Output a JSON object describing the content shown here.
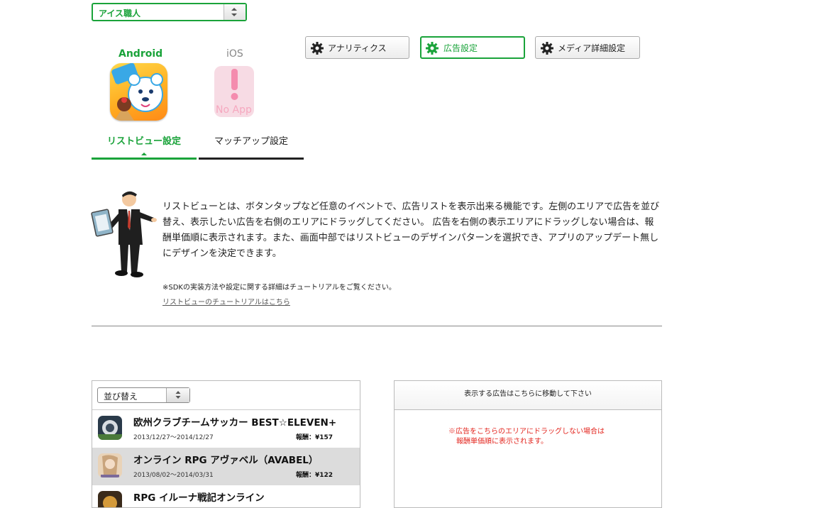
{
  "app_select": {
    "value": "アイス職人"
  },
  "platforms": {
    "android": {
      "label": "Android"
    },
    "ios": {
      "label": "iOS",
      "no_app_text": "No App"
    }
  },
  "buttons": {
    "analytics": "アナリティクス",
    "ad_settings": "広告設定",
    "media_settings": "メディア詳細設定"
  },
  "tabs": {
    "listview": "リストビュー設定",
    "matchup": "マッチアップ設定"
  },
  "description": "リストビューとは、ボタンタップなど任意のイベントで、広告リストを表示出来る機能です。左側のエリアで広告を並び替え、表示したい広告を右側のエリアにドラッグしてください。 広告を右側の表示エリアにドラッグしない場合は、報酬単価順に表示されます。また、画面中部ではリストビューのデザインパターンを選択でき、アプリのアップデート無しにデザインを決定できます。",
  "note": "※SDKの実装方法や設定に関する詳細はチュートリアルをご覧ください。",
  "tutorial_link": "リストビューのチュートリアルはこちら",
  "sort_select": {
    "value": "並び替え"
  },
  "ads": [
    {
      "title": "欧州クラブチームサッカー BEST☆ELEVEN+",
      "period": "2013/12/27〜2014/12/27",
      "reward": "報酬：¥157"
    },
    {
      "title": "オンライン RPG アヴァベル（AVABEL）",
      "period": "2013/08/02〜2014/03/31",
      "reward": "報酬：¥122"
    },
    {
      "title": "RPG イルーナ戦記オンライン",
      "period": "",
      "reward": ""
    }
  ],
  "right_panel": {
    "header": "表示する広告はこちらに移動して下さい",
    "note_line1": "※広告をこちらのエリアにドラッグしない場合は",
    "note_line2": "報酬単価順に表示されます。"
  },
  "colors": {
    "accent": "#1aa33a",
    "warning": "#e3251e"
  }
}
